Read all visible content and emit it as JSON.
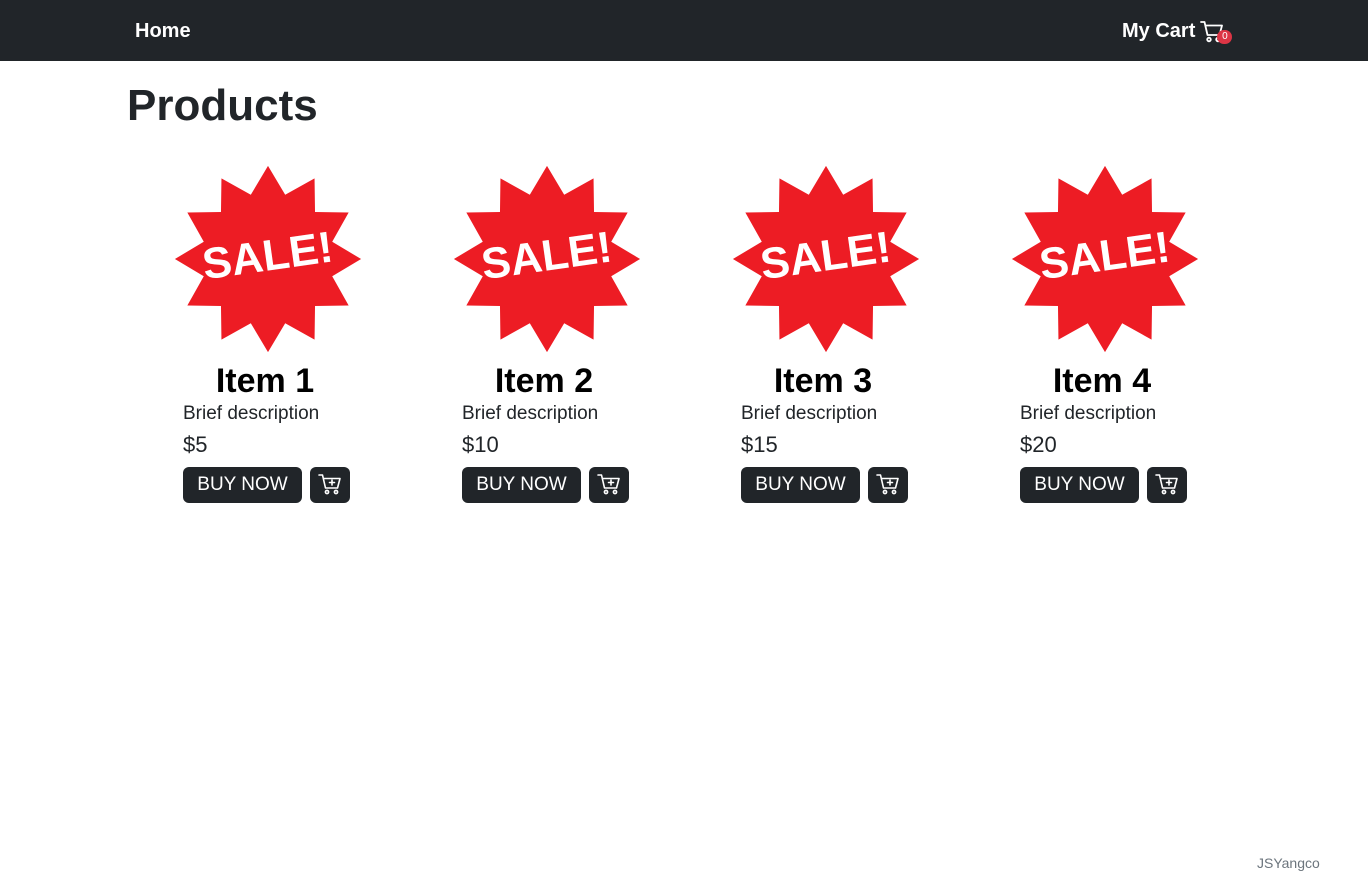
{
  "navbar": {
    "home_label": "Home",
    "cart_label": "My Cart",
    "cart_icon": "cart-icon",
    "cart_count": "0",
    "background": "#212529",
    "badge_color": "#dc3545"
  },
  "page": {
    "title": "Products"
  },
  "products": [
    {
      "image_text": "SALE!",
      "name": "Item 1",
      "description": "Brief description",
      "price": "$5",
      "buy_label": "BUY NOW",
      "add_icon": "cart-plus-icon"
    },
    {
      "image_text": "SALE!",
      "name": "Item 2",
      "description": "Brief description",
      "price": "$10",
      "buy_label": "BUY NOW",
      "add_icon": "cart-plus-icon"
    },
    {
      "image_text": "SALE!",
      "name": "Item 3",
      "description": "Brief description",
      "price": "$15",
      "buy_label": "BUY NOW",
      "add_icon": "cart-plus-icon"
    },
    {
      "image_text": "SALE!",
      "name": "Item 4",
      "description": "Brief description",
      "price": "$20",
      "buy_label": "BUY NOW",
      "add_icon": "cart-plus-icon"
    }
  ],
  "colors": {
    "sale_badge": "#ed1c24",
    "button": "#212529"
  },
  "footer": {
    "credit": "JSYangco"
  }
}
